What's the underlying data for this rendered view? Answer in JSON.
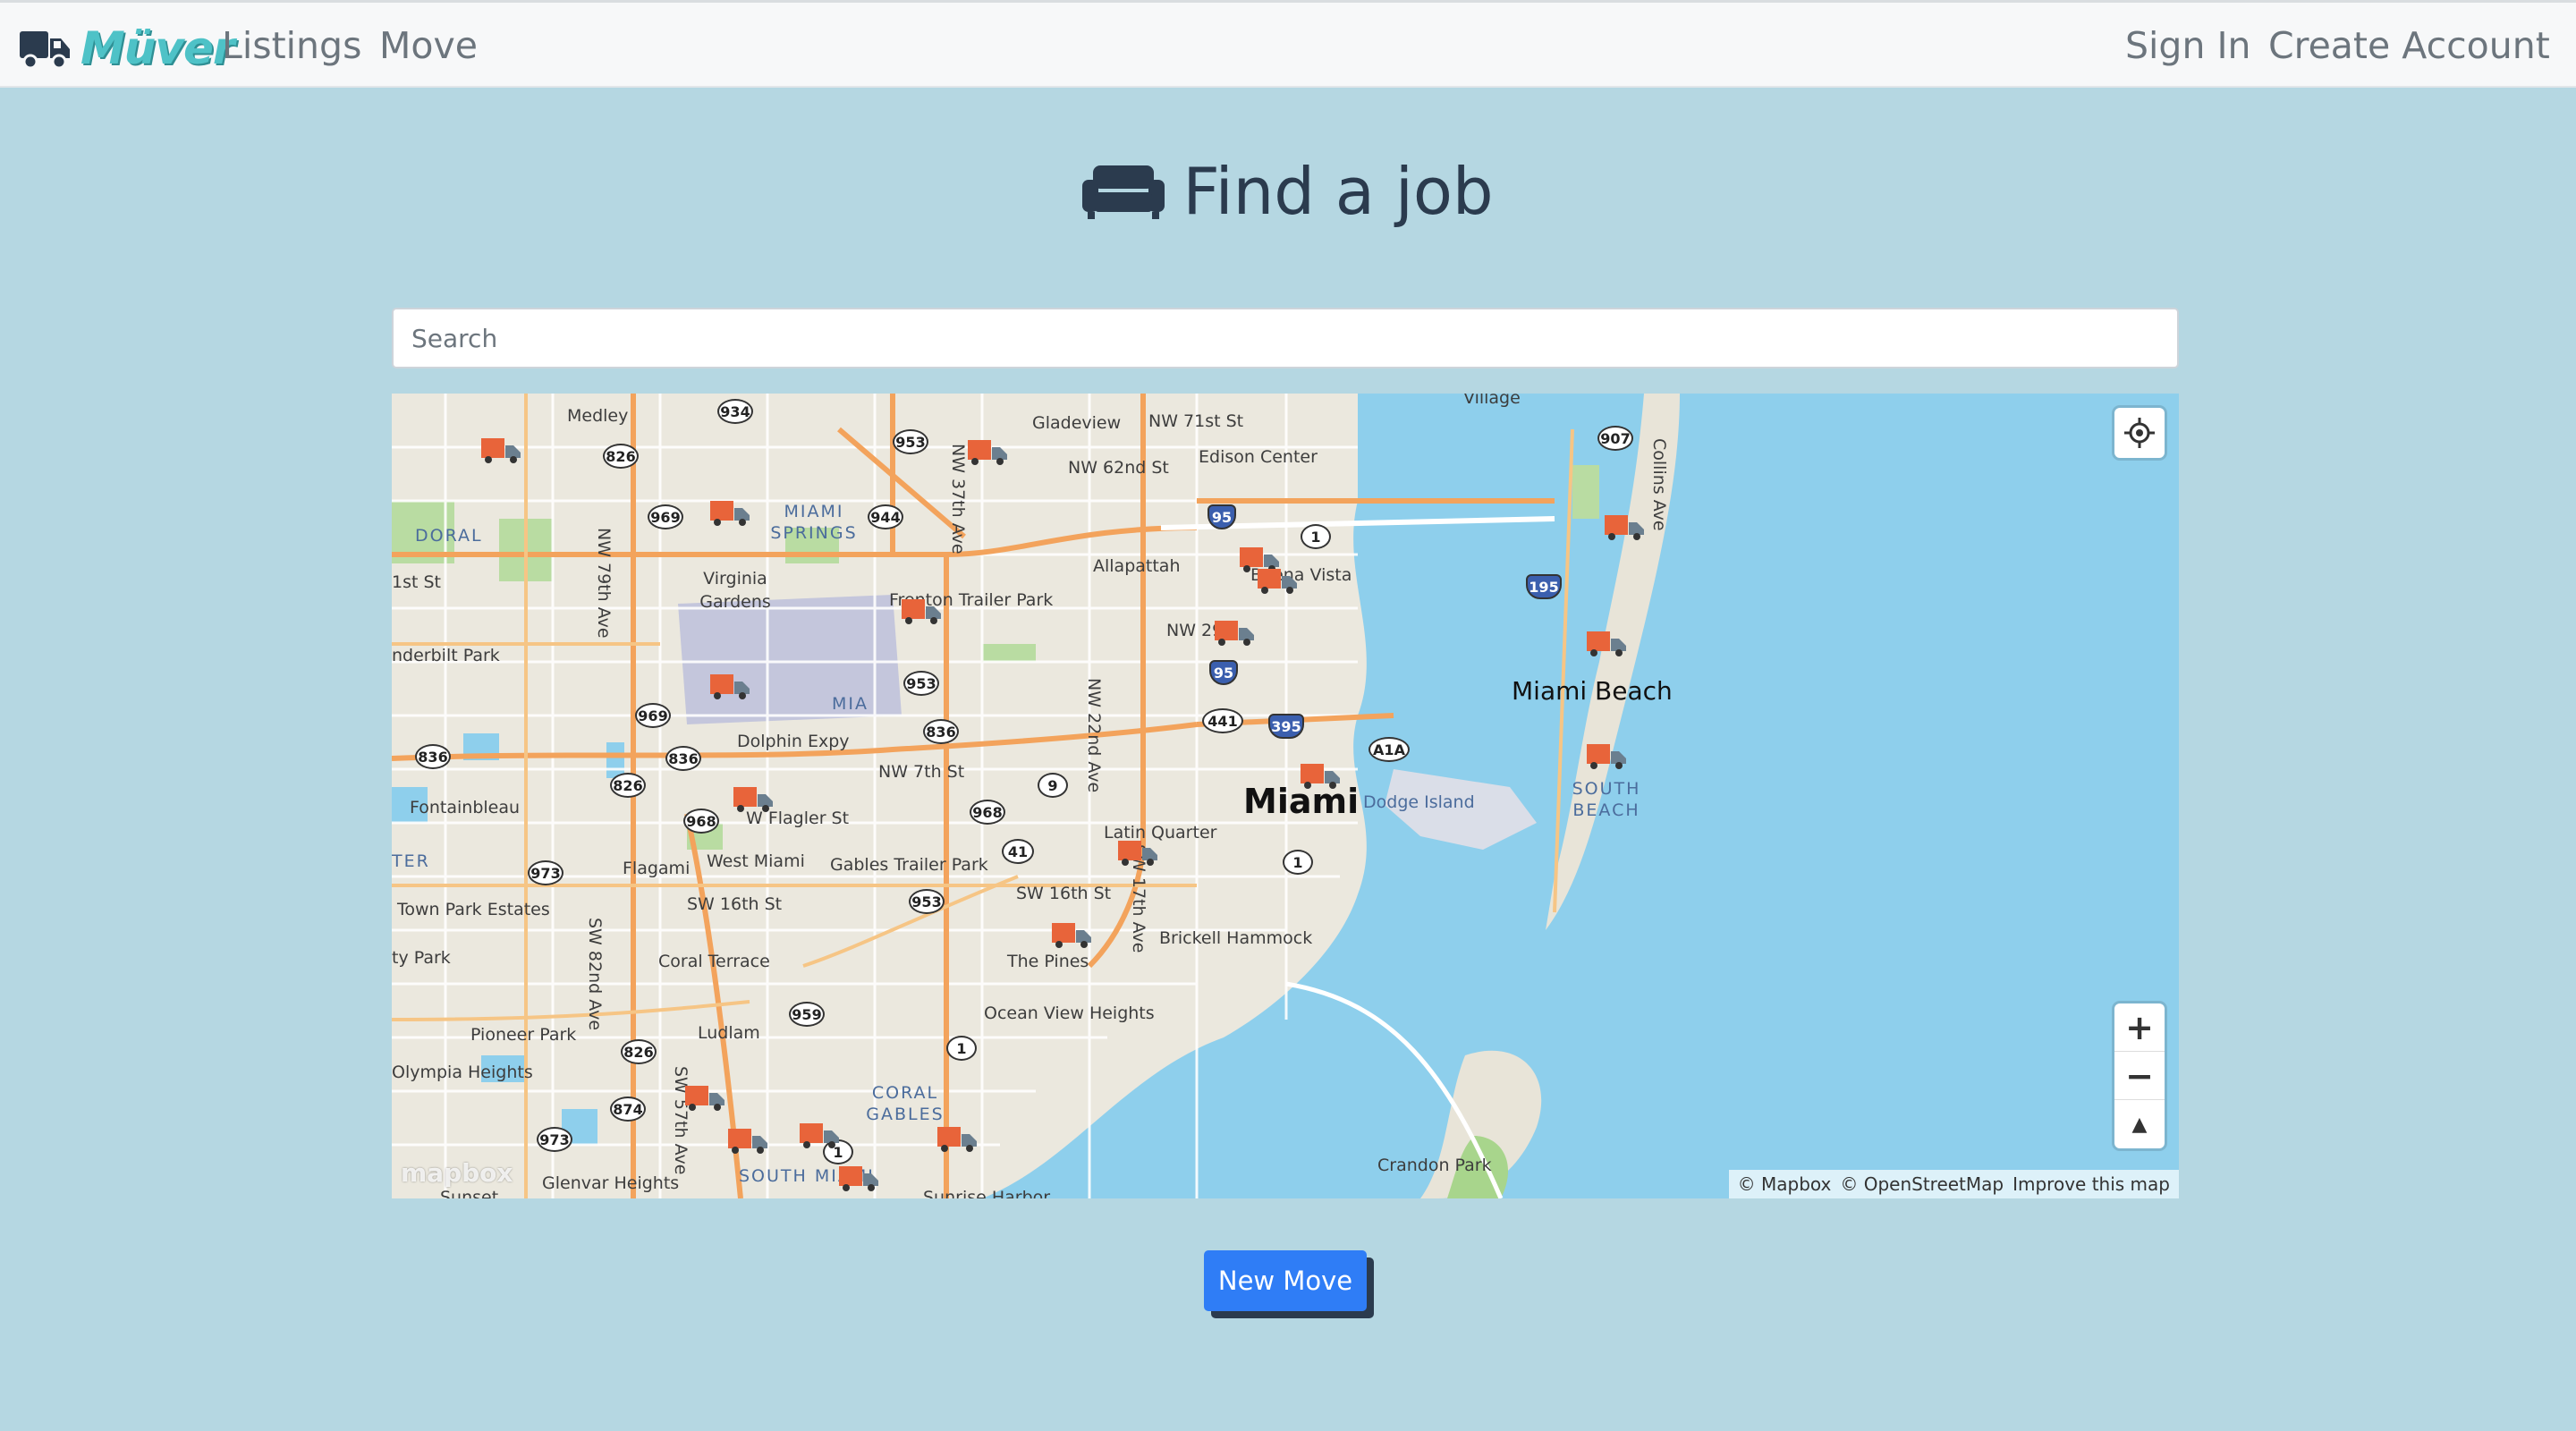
{
  "nav": {
    "brand": "Müver",
    "links": [
      "Listings",
      "Move"
    ],
    "right_links": [
      "Sign In",
      "Create Account"
    ]
  },
  "page": {
    "title": "Find a job",
    "icon": "sofa-icon"
  },
  "search": {
    "placeholder": "Search",
    "value": ""
  },
  "map": {
    "labels": {
      "medley": "Medley",
      "gladeview": "Gladeview",
      "village": "Village",
      "nw71": "NW 71st St",
      "nw62": "NW 62nd St",
      "edison": "Edison Center",
      "doral": "DORAL",
      "miami_springs": "MIAMI SPRINGS",
      "virginia": "Virginia Gardens",
      "allapattah": "Allapattah",
      "buena": "Buena Vista",
      "fst": "1st St",
      "nderbilt": "nderbilt Park",
      "frenton": "Frenton Trailer Park",
      "nw29": "NW 29",
      "mia": "MIA",
      "miami_beach": "Miami Beach",
      "dolphin": "Dolphin Expy",
      "nw7": "NW 7th St",
      "miami": "Miami",
      "dodge": "Dodge Island",
      "south_beach": "SOUTH BEACH",
      "fontainebleau": "Fontainbleau",
      "flagler": "W Flagler St",
      "latin": "Latin Quarter",
      "ter": "TER",
      "flagami": "Flagami",
      "west_miami": "West Miami",
      "gables_tp": "Gables Trailer Park",
      "town_park": "Town Park Estates",
      "sw16": "SW 16th St",
      "sw16b": "SW 16th St",
      "ty_park": "ty Park",
      "coral_terrace": "Coral Terrace",
      "pines": "The Pines",
      "brickell": "Brickell Hammock",
      "ovh": "Ocean View Heights",
      "pioneer": "Pioneer Park",
      "ludlam": "Ludlam",
      "olympia": "Olympia Heights",
      "coral_gables": "CORAL GABLES",
      "crandon": "Crandon Park",
      "glenvar": "Glenvar Heights",
      "south_miami": "SOUTH MIAMI",
      "sunset": "Sunset",
      "sunrise": "Sunrise Harbor",
      "nw37": "NW 37th Ave",
      "nw79": "NW 79th Ave",
      "nw22": "NW 22nd Ave",
      "sw17": "SW 17th Ave",
      "sw82": "SW 82nd Ave",
      "sw57": "SW 57th Ave",
      "collins": "Collins Ave"
    },
    "shields": [
      "934",
      "826",
      "953",
      "969",
      "944",
      "907",
      "1",
      "95",
      "195",
      "953",
      "969",
      "836",
      "836",
      "836",
      "826",
      "441",
      "395",
      "A1A",
      "9",
      "968",
      "968",
      "41",
      "973",
      "1",
      "953",
      "959",
      "1",
      "826",
      "874",
      "973",
      "1",
      "95"
    ],
    "attribution": [
      "© Mapbox",
      "© OpenStreetMap",
      "Improve this map"
    ],
    "logo": "mapbox",
    "zoom_in": "+",
    "zoom_out": "−",
    "compass": "▲"
  },
  "actions": {
    "new_move": "New Move"
  }
}
